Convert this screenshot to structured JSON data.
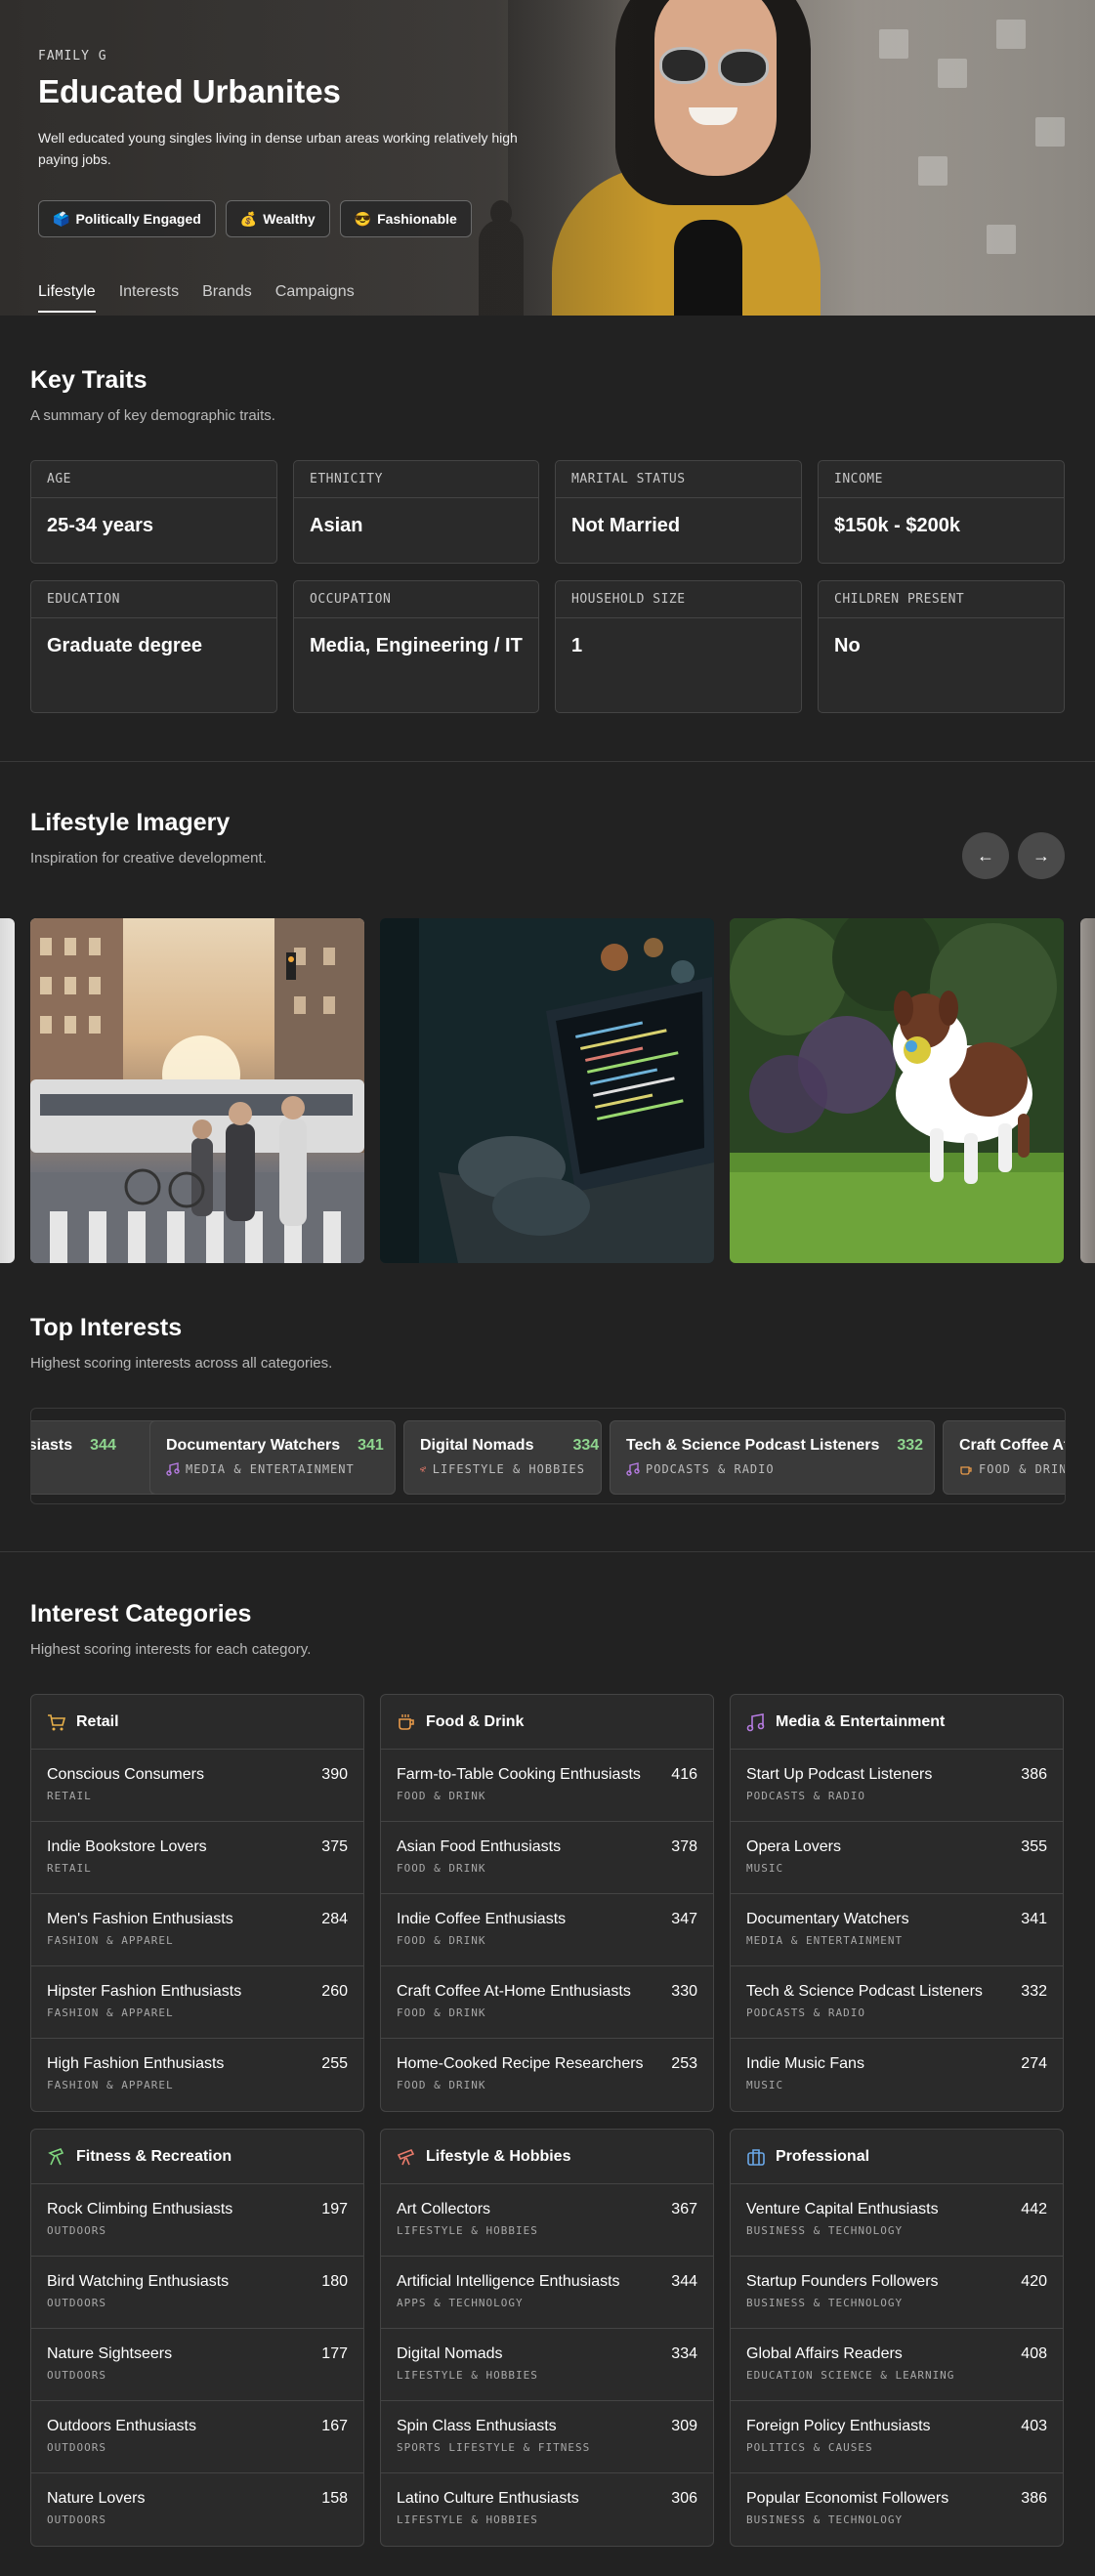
{
  "hero": {
    "eyebrow": "FAMILY G",
    "title": "Educated Urbanites",
    "description": "Well educated young singles living in dense urban areas working relatively high paying jobs.",
    "badges": [
      {
        "icon": "🗳️",
        "label": "Politically Engaged"
      },
      {
        "icon": "💰",
        "label": "Wealthy"
      },
      {
        "icon": "😎",
        "label": "Fashionable"
      }
    ],
    "tabs": [
      "Lifestyle",
      "Interests",
      "Brands",
      "Campaigns"
    ],
    "active_tab": "Lifestyle"
  },
  "key_traits": {
    "title": "Key Traits",
    "subtitle": "A summary of key demographic traits.",
    "items": [
      {
        "label": "AGE",
        "value": "25-34 years"
      },
      {
        "label": "ETHNICITY",
        "value": "Asian"
      },
      {
        "label": "MARITAL STATUS",
        "value": "Not Married"
      },
      {
        "label": "INCOME",
        "value": "$150k - $200k"
      },
      {
        "label": "EDUCATION",
        "value": "Graduate degree"
      },
      {
        "label": "OCCUPATION",
        "value": "Media, Engineering / IT"
      },
      {
        "label": "HOUSEHOLD SIZE",
        "value": "1"
      },
      {
        "label": "CHILDREN PRESENT",
        "value": "No"
      }
    ]
  },
  "imagery": {
    "title": "Lifestyle Imagery",
    "subtitle": "Inspiration for creative development.",
    "prev_icon": "←",
    "next_icon": "→"
  },
  "top_interests": {
    "title": "Top Interests",
    "subtitle": "Highest scoring interests across all categories.",
    "chips": [
      {
        "name": "usiasts",
        "score": "344",
        "category": "",
        "icon": ""
      },
      {
        "name": "Documentary Watchers",
        "score": "341",
        "category": "MEDIA & ENTERTAINMENT",
        "icon": "music-icon"
      },
      {
        "name": "Digital Nomads",
        "score": "334",
        "category": "LIFESTYLE & HOBBIES",
        "icon": "telescope-icon"
      },
      {
        "name": "Tech & Science Podcast Listeners",
        "score": "332",
        "category": "PODCASTS & RADIO",
        "icon": "music-icon"
      },
      {
        "name": "Craft Coffee At-",
        "score": "",
        "category": "FOOD & DRINK",
        "icon": "coffee-icon"
      }
    ]
  },
  "interest_categories": {
    "title": "Interest Categories",
    "subtitle": "Highest scoring interests for each category.",
    "cards": [
      {
        "title": "Retail",
        "icon": "cart-icon",
        "accent": "#e8b04a",
        "rows": [
          {
            "name": "Conscious Consumers",
            "cat": "RETAIL",
            "score": "390"
          },
          {
            "name": "Indie Bookstore Lovers",
            "cat": "RETAIL",
            "score": "375"
          },
          {
            "name": "Men's Fashion Enthusiasts",
            "cat": "FASHION & APPAREL",
            "score": "284"
          },
          {
            "name": "Hipster Fashion Enthusiasts",
            "cat": "FASHION & APPAREL",
            "score": "260"
          },
          {
            "name": "High Fashion Enthusiasts",
            "cat": "FASHION & APPAREL",
            "score": "255"
          }
        ]
      },
      {
        "title": "Food & Drink",
        "icon": "coffee-icon",
        "accent": "#e89a4a",
        "rows": [
          {
            "name": "Farm-to-Table Cooking Enthusiasts",
            "cat": "FOOD & DRINK",
            "score": "416"
          },
          {
            "name": "Asian Food Enthusiasts",
            "cat": "FOOD & DRINK",
            "score": "378"
          },
          {
            "name": "Indie Coffee Enthusiasts",
            "cat": "FOOD & DRINK",
            "score": "347"
          },
          {
            "name": "Craft Coffee At-Home Enthusiasts",
            "cat": "FOOD & DRINK",
            "score": "330"
          },
          {
            "name": "Home-Cooked Recipe Researchers",
            "cat": "FOOD & DRINK",
            "score": "253"
          }
        ]
      },
      {
        "title": "Media & Entertainment",
        "icon": "music-icon",
        "accent": "#b57be0",
        "rows": [
          {
            "name": "Start Up Podcast Listeners",
            "cat": "PODCASTS & RADIO",
            "score": "386"
          },
          {
            "name": "Opera Lovers",
            "cat": "MUSIC",
            "score": "355"
          },
          {
            "name": "Documentary Watchers",
            "cat": "MEDIA & ENTERTAINMENT",
            "score": "341"
          },
          {
            "name": "Tech & Science Podcast Listeners",
            "cat": "PODCASTS & RADIO",
            "score": "332"
          },
          {
            "name": "Indie Music Fans",
            "cat": "MUSIC",
            "score": "274"
          }
        ]
      },
      {
        "title": "Fitness & Recreation",
        "icon": "runner-icon",
        "accent": "#7fd67f",
        "rows": [
          {
            "name": "Rock Climbing Enthusiasts",
            "cat": "OUTDOORS",
            "score": "197"
          },
          {
            "name": "Bird Watching Enthusiasts",
            "cat": "OUTDOORS",
            "score": "180"
          },
          {
            "name": "Nature Sightseers",
            "cat": "OUTDOORS",
            "score": "177"
          },
          {
            "name": "Outdoors Enthusiasts",
            "cat": "OUTDOORS",
            "score": "167"
          },
          {
            "name": "Nature Lovers",
            "cat": "OUTDOORS",
            "score": "158"
          }
        ]
      },
      {
        "title": "Lifestyle & Hobbies",
        "icon": "telescope-icon",
        "accent": "#e87a6a",
        "rows": [
          {
            "name": "Art Collectors",
            "cat": "LIFESTYLE & HOBBIES",
            "score": "367"
          },
          {
            "name": "Artificial Intelligence Enthusiasts",
            "cat": "APPS & TECHNOLOGY",
            "score": "344"
          },
          {
            "name": "Digital Nomads",
            "cat": "LIFESTYLE & HOBBIES",
            "score": "334"
          },
          {
            "name": "Spin Class Enthusiasts",
            "cat": "SPORTS LIFESTYLE & FITNESS",
            "score": "309"
          },
          {
            "name": "Latino Culture Enthusiasts",
            "cat": "LIFESTYLE & HOBBIES",
            "score": "306"
          }
        ]
      },
      {
        "title": "Professional",
        "icon": "briefcase-icon",
        "accent": "#6aa8e8",
        "rows": [
          {
            "name": "Venture Capital Enthusiasts",
            "cat": "BUSINESS & TECHNOLOGY",
            "score": "442"
          },
          {
            "name": "Startup Founders Followers",
            "cat": "BUSINESS & TECHNOLOGY",
            "score": "420"
          },
          {
            "name": "Global Affairs Readers",
            "cat": "EDUCATION SCIENCE & LEARNING",
            "score": "408"
          },
          {
            "name": "Foreign Policy Enthusiasts",
            "cat": "POLITICS & CAUSES",
            "score": "403"
          },
          {
            "name": "Popular Economist Followers",
            "cat": "BUSINESS & TECHNOLOGY",
            "score": "386"
          }
        ]
      }
    ]
  }
}
